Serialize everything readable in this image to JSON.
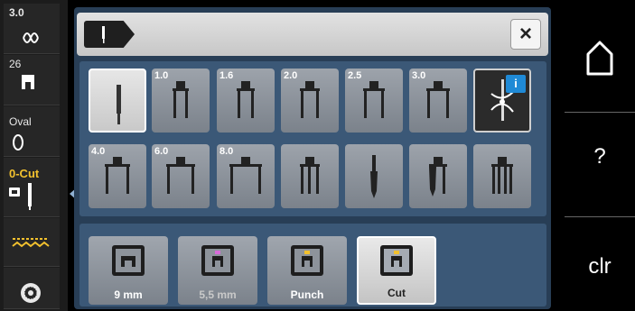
{
  "sidebar": {
    "items": [
      {
        "label": "3.0",
        "icon": "stitch-pattern-icon"
      },
      {
        "label": "26",
        "icon": "presser-foot-icon"
      },
      {
        "label": "Oval",
        "icon": "hoop-oval-icon"
      },
      {
        "label": "0-Cut",
        "icon": "foot-cut-icon",
        "color": "#f2c12e"
      },
      {
        "label": "",
        "icon": "feed-dog-icon"
      },
      {
        "label": "",
        "icon": "bobbin-icon"
      }
    ]
  },
  "topbar": {
    "tab_icon": "needle-icon",
    "close_label": "×"
  },
  "needles": {
    "row1": [
      {
        "label": "",
        "icon": "single-needle-icon",
        "selected": true
      },
      {
        "label": "1.0",
        "icon": "twin-needle-icon"
      },
      {
        "label": "1.6",
        "icon": "twin-needle-icon"
      },
      {
        "label": "2.0",
        "icon": "twin-needle-icon"
      },
      {
        "label": "2.5",
        "icon": "twin-needle-icon"
      },
      {
        "label": "3.0",
        "icon": "twin-needle-icon"
      },
      {
        "label": "",
        "icon": "needle-threader-info-icon",
        "badge": "i"
      }
    ],
    "row2": [
      {
        "label": "4.0",
        "icon": "twin-needle-icon"
      },
      {
        "label": "6.0",
        "icon": "twin-needle-icon"
      },
      {
        "label": "8.0",
        "icon": "twin-needle-icon"
      },
      {
        "label": "",
        "icon": "triple-needle-icon"
      },
      {
        "label": "",
        "icon": "wing-needle-icon"
      },
      {
        "label": "",
        "icon": "wing-twin-needle-icon"
      },
      {
        "label": "",
        "icon": "quad-needle-icon"
      }
    ]
  },
  "stitch_plates": [
    {
      "label": "9 mm",
      "marker_color": ""
    },
    {
      "label": "5,5 mm",
      "marker_color": "#d86bd8"
    },
    {
      "label": "Punch",
      "marker_color": "#f2c12e"
    },
    {
      "label": "Cut",
      "marker_color": "#f2c12e",
      "selected": true
    }
  ],
  "right_bar": {
    "home_icon": "home-icon",
    "help_label": "?",
    "clear_label": "clr"
  },
  "colors": {
    "panel": "#283e56",
    "accent_yellow": "#f2c12e",
    "info_blue": "#1f8ad6"
  }
}
